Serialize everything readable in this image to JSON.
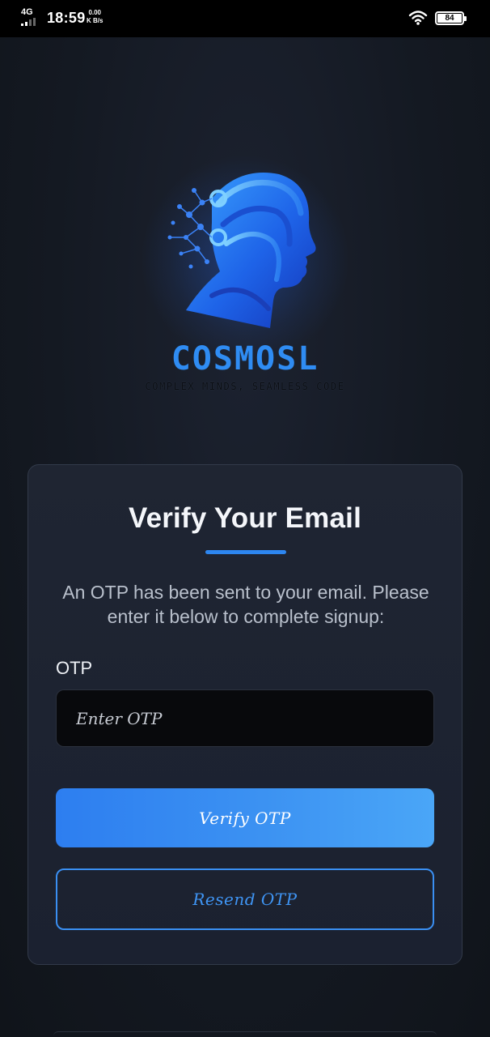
{
  "status_bar": {
    "network": "4G",
    "time": "18:59",
    "speed_value": "0.00",
    "speed_unit": "K B/s",
    "battery_level": "84"
  },
  "brand": {
    "name": "COSMOSL",
    "tagline": "COMPLEX MINDS, SEAMLESS CODE",
    "logo_icon": "ai-head-circuit-icon"
  },
  "verify_card": {
    "title": "Verify Your Email",
    "description": "An OTP has been sent to your email. Please enter it below to complete signup:",
    "otp_label": "OTP",
    "otp_value": "",
    "otp_placeholder": "Enter OTP",
    "verify_button_label": "Verify OTP",
    "resend_button_label": "Resend OTP"
  },
  "colors": {
    "accent": "#2d86f0",
    "background": "#141922",
    "card": "#1f2532",
    "input_bg": "#08090c"
  }
}
